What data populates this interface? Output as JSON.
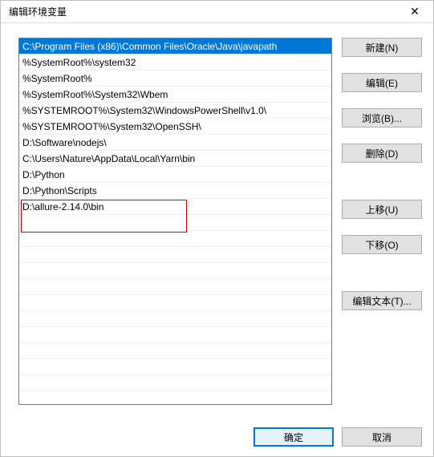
{
  "window": {
    "title": "编辑环境变量"
  },
  "list": {
    "items": [
      "C:\\Program Files (x86)\\Common Files\\Oracle\\Java\\javapath",
      "%SystemRoot%\\system32",
      "%SystemRoot%",
      "%SystemRoot%\\System32\\Wbem",
      "%SYSTEMROOT%\\System32\\WindowsPowerShell\\v1.0\\",
      "%SYSTEMROOT%\\System32\\OpenSSH\\",
      "D:\\Software\\nodejs\\",
      "C:\\Users\\Nature\\AppData\\Local\\Yarn\\bin",
      "D:\\Python",
      "D:\\Python\\Scripts",
      "D:\\allure-2.14.0\\bin"
    ],
    "selected_index": 0
  },
  "buttons": {
    "new": "新建(N)",
    "edit": "编辑(E)",
    "browse": "浏览(B)...",
    "delete": "删除(D)",
    "moveup": "上移(U)",
    "movedown": "下移(O)",
    "edittext": "编辑文本(T)..."
  },
  "footer": {
    "ok": "确定",
    "cancel": "取消"
  }
}
